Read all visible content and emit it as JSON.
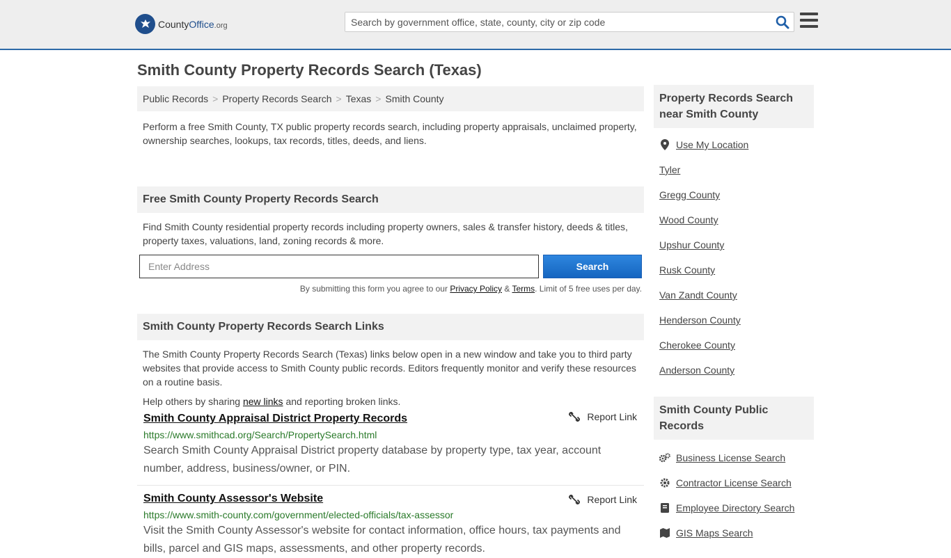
{
  "header": {
    "logo_text_a": "County",
    "logo_text_b": "Office",
    "logo_text_c": ".org",
    "search_placeholder": "Search by government office, state, county, city or zip code"
  },
  "page_title": "Smith County Property Records Search (Texas)",
  "breadcrumb": [
    "Public Records",
    "Property Records Search",
    "Texas",
    "Smith County"
  ],
  "intro": "Perform a free Smith County, TX public property records search, including property appraisals, unclaimed property, ownership searches, lookups, tax records, titles, deeds, and liens.",
  "free_search": {
    "heading": "Free Smith County Property Records Search",
    "desc": "Find Smith County residential property records including property owners, sales & transfer history, deeds & titles, property taxes, valuations, land, zoning records & more.",
    "input_placeholder": "Enter Address",
    "button": "Search",
    "terms_prefix": "By submitting this form you agree to our ",
    "privacy": "Privacy Policy",
    "amp": " & ",
    "terms": "Terms",
    "terms_suffix": ". Limit of 5 free uses per day."
  },
  "links_section": {
    "heading": "Smith County Property Records Search Links",
    "desc": "The Smith County Property Records Search (Texas) links below open in a new window and take you to third party websites that provide access to Smith County public records. Editors frequently monitor and verify these resources on a routine basis.",
    "share_prefix": "Help others by sharing ",
    "share_link": "new links",
    "share_suffix": " and reporting broken links.",
    "items": [
      {
        "title": "Smith County Appraisal District Property Records",
        "report": "Report Link",
        "url": "https://www.smithcad.org/Search/PropertySearch.html",
        "desc": "Search Smith County Appraisal District property database by property type, tax year, account number, address, business/owner, or PIN."
      },
      {
        "title": "Smith County Assessor's Website",
        "report": "Report Link",
        "url": "https://www.smith-county.com/government/elected-officials/tax-assessor",
        "desc": "Visit the Smith County Assessor's website for contact information, office hours, tax payments and bills, parcel and GIS maps, assessments, and other property records."
      }
    ]
  },
  "sidebar": {
    "nearby_heading": "Property Records Search near Smith County",
    "nearby": [
      "Use My Location",
      "Tyler",
      "Gregg County",
      "Wood County",
      "Upshur County",
      "Rusk County",
      "Van Zandt County",
      "Henderson County",
      "Cherokee County",
      "Anderson County"
    ],
    "public_heading": "Smith County Public Records",
    "public": [
      {
        "label": "Business License Search",
        "icon": "gears-icon"
      },
      {
        "label": "Contractor License Search",
        "icon": "gear-icon"
      },
      {
        "label": "Employee Directory Search",
        "icon": "book-icon"
      },
      {
        "label": "GIS Maps Search",
        "icon": "map-icon"
      }
    ]
  },
  "colors": {
    "accent": "#2d6aa8",
    "button": "#1e74d0",
    "url_green": "#2a7a2a"
  }
}
